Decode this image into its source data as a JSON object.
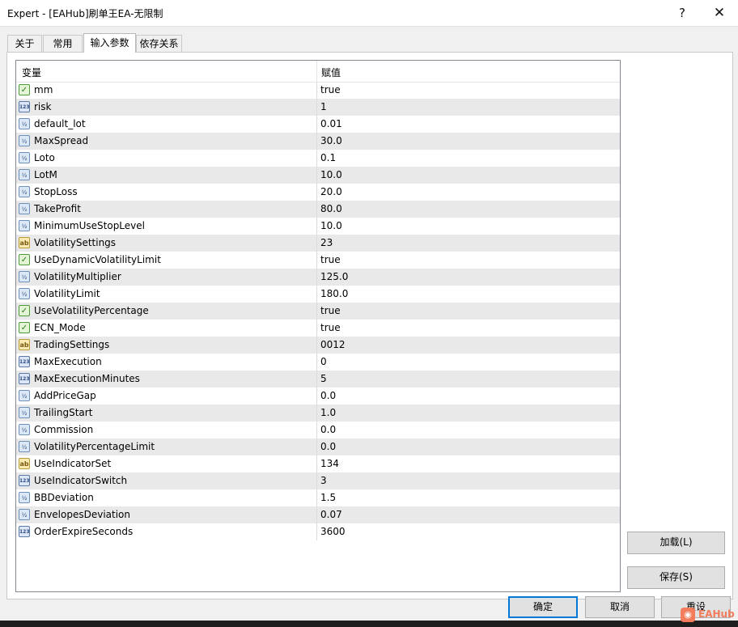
{
  "window": {
    "title": "Expert - [EAHub]刷单王EA-无限制",
    "help_label": "?",
    "close_label": "✕"
  },
  "tabs": [
    {
      "label": "关于",
      "active": false
    },
    {
      "label": "常用",
      "active": false
    },
    {
      "label": "输入参数",
      "active": true
    },
    {
      "label": "依存关系",
      "active": false
    }
  ],
  "grid": {
    "headers": {
      "variable": "变量",
      "value": "赋值"
    },
    "rows": [
      {
        "type": "bool",
        "icon": "bool-icon",
        "name": "mm",
        "value": "true"
      },
      {
        "type": "int",
        "icon": "int-icon",
        "name": "risk",
        "value": "1"
      },
      {
        "type": "double",
        "icon": "double-icon",
        "name": "default_lot",
        "value": "0.01"
      },
      {
        "type": "double",
        "icon": "double-icon",
        "name": "MaxSpread",
        "value": "30.0"
      },
      {
        "type": "double",
        "icon": "double-icon",
        "name": "Loto",
        "value": "0.1"
      },
      {
        "type": "double",
        "icon": "double-icon",
        "name": "LotM",
        "value": "10.0"
      },
      {
        "type": "double",
        "icon": "double-icon",
        "name": "StopLoss",
        "value": "20.0"
      },
      {
        "type": "double",
        "icon": "double-icon",
        "name": "TakeProfit",
        "value": "80.0"
      },
      {
        "type": "double",
        "icon": "double-icon",
        "name": "MinimumUseStopLevel",
        "value": "10.0"
      },
      {
        "type": "str",
        "icon": "string-icon",
        "name": "VolatilitySettings",
        "value": "23"
      },
      {
        "type": "bool",
        "icon": "bool-icon",
        "name": "UseDynamicVolatilityLimit",
        "value": "true"
      },
      {
        "type": "double",
        "icon": "double-icon",
        "name": "VolatilityMultiplier",
        "value": "125.0"
      },
      {
        "type": "double",
        "icon": "double-icon",
        "name": "VolatilityLimit",
        "value": "180.0"
      },
      {
        "type": "bool",
        "icon": "bool-icon",
        "name": "UseVolatilityPercentage",
        "value": "true"
      },
      {
        "type": "bool",
        "icon": "bool-icon",
        "name": "ECN_Mode",
        "value": "true"
      },
      {
        "type": "str",
        "icon": "string-icon",
        "name": "TradingSettings",
        "value": "0012"
      },
      {
        "type": "int",
        "icon": "int-icon",
        "name": "MaxExecution",
        "value": "0"
      },
      {
        "type": "int",
        "icon": "int-icon",
        "name": "MaxExecutionMinutes",
        "value": "5"
      },
      {
        "type": "double",
        "icon": "double-icon",
        "name": "AddPriceGap",
        "value": "0.0"
      },
      {
        "type": "double",
        "icon": "double-icon",
        "name": "TrailingStart",
        "value": "1.0"
      },
      {
        "type": "double",
        "icon": "double-icon",
        "name": "Commission",
        "value": "0.0"
      },
      {
        "type": "double",
        "icon": "double-icon",
        "name": "VolatilityPercentageLimit",
        "value": "0.0"
      },
      {
        "type": "str",
        "icon": "string-icon",
        "name": "UseIndicatorSet",
        "value": "134"
      },
      {
        "type": "int",
        "icon": "int-icon",
        "name": "UseIndicatorSwitch",
        "value": "3"
      },
      {
        "type": "double",
        "icon": "double-icon",
        "name": "BBDeviation",
        "value": "1.5"
      },
      {
        "type": "double",
        "icon": "double-icon",
        "name": "EnvelopesDeviation",
        "value": "0.07"
      },
      {
        "type": "int",
        "icon": "int-icon",
        "name": "OrderExpireSeconds",
        "value": "3600"
      }
    ]
  },
  "buttons": {
    "load": "加载(L)",
    "save": "保存(S)",
    "ok": "确定",
    "cancel": "取消",
    "reset": "重设"
  },
  "watermark": "EAHub"
}
